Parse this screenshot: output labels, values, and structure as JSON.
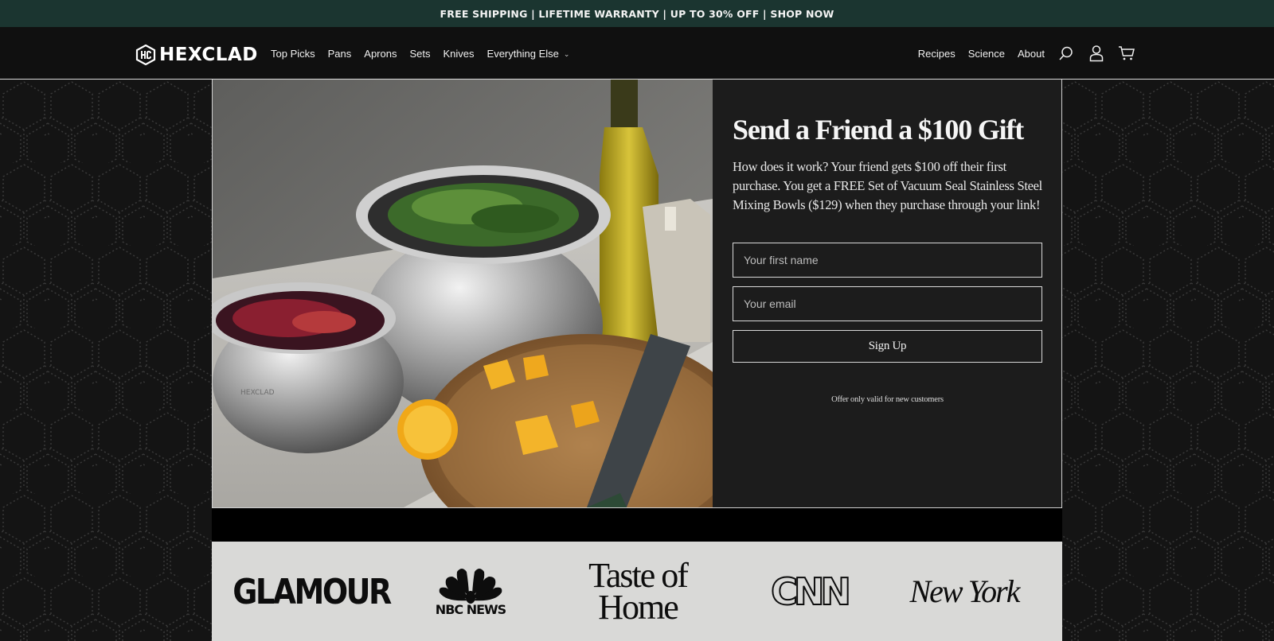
{
  "announcement": {
    "text": "FREE SHIPPING | LIFETIME WARRANTY | UP TO 30% OFF | SHOP NOW"
  },
  "header": {
    "logo_text": "HEXCLAD",
    "nav_left": [
      "Top Picks",
      "Pans",
      "Aprons",
      "Sets",
      "Knives",
      "Everything Else"
    ],
    "nav_right": [
      "Recipes",
      "Science",
      "About"
    ],
    "icons": [
      "search-icon",
      "account-icon",
      "cart-icon"
    ]
  },
  "referral": {
    "headline": "Send a Friend a $100 Gift",
    "body": "How does it work? Your friend gets $100 off their first purchase. You get a FREE Set of Vacuum Seal Stainless Steel Mixing Bowls ($129) when they purchase through your link!",
    "first_name_placeholder": "Your first name",
    "email_placeholder": "Your email",
    "submit_label": "Sign Up",
    "fine_print": "Offer only valid for new customers"
  },
  "press": {
    "logos": [
      "GLAMOUR",
      "NBC NEWS",
      "Taste of Home",
      "CNN",
      "New York"
    ]
  },
  "colors": {
    "announcement_bg": "#1b3530",
    "header_bg": "#101010",
    "panel_bg": "#1c1c1c",
    "press_bg": "#d9d9d7"
  }
}
